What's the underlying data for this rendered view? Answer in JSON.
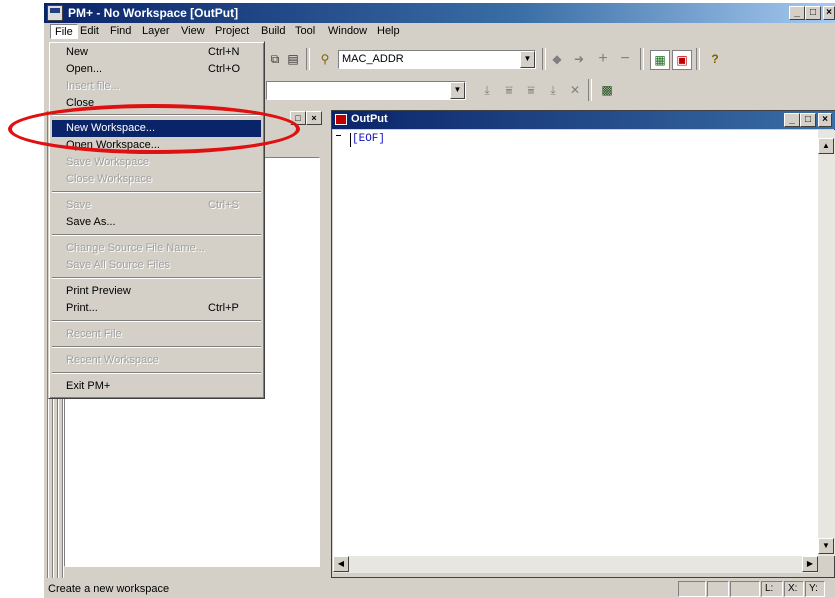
{
  "window": {
    "title": "PM+ - No Workspace [OutPut]"
  },
  "menubar": {
    "items": [
      "File",
      "Edit",
      "Find",
      "Layer",
      "View",
      "Project",
      "Build",
      "Tool",
      "Window",
      "Help"
    ]
  },
  "toolbar": {
    "combo_value": "MAC_ADDR",
    "combo2_value": ""
  },
  "file_menu": {
    "items": [
      {
        "label": "New",
        "shortcut": "Ctrl+N",
        "disabled": false
      },
      {
        "label": "Open...",
        "shortcut": "Ctrl+O",
        "disabled": false
      },
      {
        "label": "Insert file...",
        "shortcut": "",
        "disabled": true
      },
      {
        "label": "Close",
        "shortcut": "",
        "disabled": false
      },
      {
        "label": "New Workspace...",
        "shortcut": "",
        "disabled": false,
        "highlighted": true
      },
      {
        "label": "Open Workspace...",
        "shortcut": "",
        "disabled": false
      },
      {
        "label": "Save Workspace",
        "shortcut": "",
        "disabled": true
      },
      {
        "label": "Close Workspace",
        "shortcut": "",
        "disabled": true
      },
      {
        "label": "Save",
        "shortcut": "Ctrl+S",
        "disabled": true
      },
      {
        "label": "Save As...",
        "shortcut": "",
        "disabled": false
      },
      {
        "label": "Change Source File Name...",
        "shortcut": "",
        "disabled": true
      },
      {
        "label": "Save All Source Files",
        "shortcut": "",
        "disabled": true
      },
      {
        "label": "Print Preview",
        "shortcut": "",
        "disabled": false
      },
      {
        "label": "Print...",
        "shortcut": "Ctrl+P",
        "disabled": false
      },
      {
        "label": "Recent File",
        "shortcut": "",
        "disabled": true
      },
      {
        "label": "Recent Workspace",
        "shortcut": "",
        "disabled": true
      },
      {
        "label": "Exit PM+",
        "shortcut": "",
        "disabled": false
      }
    ]
  },
  "output": {
    "title": "OutPut",
    "content": "[EOF]"
  },
  "statusbar": {
    "text": "Create a new workspace",
    "l_label": "L:",
    "x_label": "X:",
    "y_label": "Y:"
  },
  "colors": {
    "highlight": "#0a246a",
    "annotation": "#e01010",
    "eof_text": "#1010c0"
  }
}
